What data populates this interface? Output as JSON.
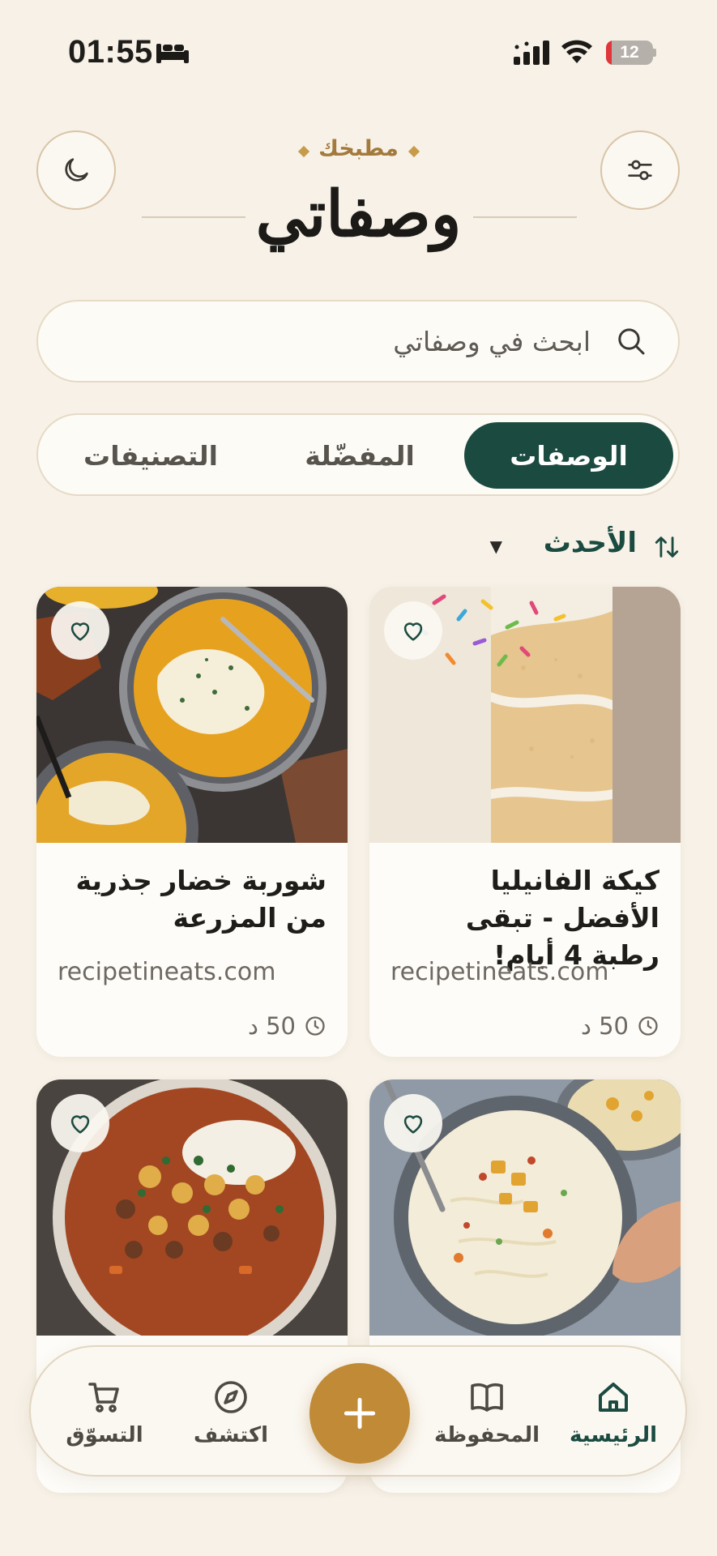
{
  "status_bar": {
    "time": "01:55",
    "battery_level": "12",
    "icons": [
      "bed-icon",
      "signal-icon",
      "wifi-icon",
      "battery-icon"
    ]
  },
  "header": {
    "kicker": "مطبخك",
    "title": "وصفاتي",
    "left_button_icon": "moon-icon",
    "right_button_icon": "sliders-icon"
  },
  "search": {
    "placeholder": "ابحث في وصفاتي",
    "icon": "search-icon"
  },
  "tabs": [
    {
      "label": "الوصفات",
      "active": true
    },
    {
      "label": "المفضّلة",
      "active": false
    },
    {
      "label": "التصنيفات",
      "active": false
    }
  ],
  "sort": {
    "label": "الأحدث",
    "caret": "▼",
    "icon": "sort-arrows-icon"
  },
  "recipes": [
    {
      "title": "كيكة الفانيليا الأفضل - تبقى رطبة 4 أيام!",
      "source": "recipetineats.com",
      "time": "50 د",
      "image": "vanilla-cake"
    },
    {
      "title": "شوربة خضار جذرية من المزرعة",
      "source": "recipetineats.com",
      "time": "50 د",
      "image": "root-vegetable-soup"
    },
    {
      "title": "",
      "source": "",
      "time": "",
      "image": "creamy-chicken-soup"
    },
    {
      "title": "",
      "source": "",
      "time": "",
      "image": "chickpea-beef-stew"
    }
  ],
  "bottom_nav": {
    "items": [
      {
        "label": "الرئيسية",
        "icon": "home-icon",
        "active": true
      },
      {
        "label": "المحفوظة",
        "icon": "book-icon",
        "active": false
      },
      {
        "label": "اكتشف",
        "icon": "compass-icon",
        "active": false
      },
      {
        "label": "التسوّق",
        "icon": "cart-icon",
        "active": false
      }
    ],
    "add_icon": "plus-icon"
  },
  "colors": {
    "background": "#f7f1e7",
    "primary_green": "#1b4b40",
    "accent_gold": "#c08a36",
    "card": "#fefcf8"
  }
}
